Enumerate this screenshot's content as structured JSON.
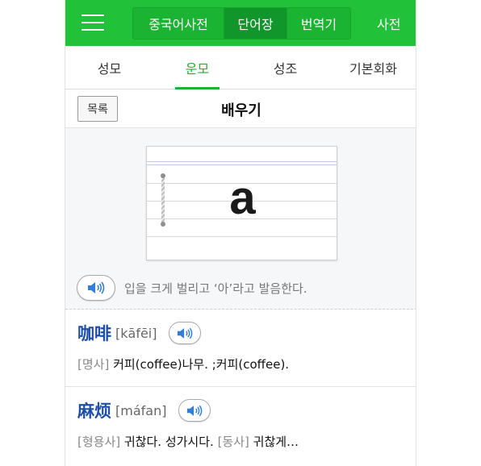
{
  "topbar": {
    "tabs": [
      {
        "label": "중국어사전",
        "active": false
      },
      {
        "label": "단어장",
        "active": true
      },
      {
        "label": "번역기",
        "active": false
      }
    ],
    "right_label": "사전"
  },
  "subtabs": [
    {
      "label": "성모",
      "active": false
    },
    {
      "label": "운모",
      "active": true
    },
    {
      "label": "성조",
      "active": false
    },
    {
      "label": "기본회화",
      "active": false
    }
  ],
  "header": {
    "list_button": "목록",
    "title": "배우기"
  },
  "learn": {
    "letter": "a",
    "pronunciation": "입을 크게 벌리고 ‘아’라고 발음한다."
  },
  "words": [
    {
      "hanzi": "咖啡",
      "pinyin": "[kāfēi]",
      "pos1": "[명사]",
      "def1": " 커피(coffee)나무. ;커피(coffee).",
      "pos2": "",
      "def2": ""
    },
    {
      "hanzi": "麻烦",
      "pinyin": "[máfan]",
      "pos1": "[형용사]",
      "def1": " 귀찮다. 성가시다. ",
      "pos2": "[동사]",
      "def2": " 귀찮게…"
    }
  ],
  "colors": {
    "brand_green": "#21c23a",
    "hanzi_blue": "#1d4fa8",
    "speaker_blue": "#2f7fd8"
  },
  "icons": {
    "menu": "hamburger-icon",
    "speaker": "speaker-icon"
  }
}
